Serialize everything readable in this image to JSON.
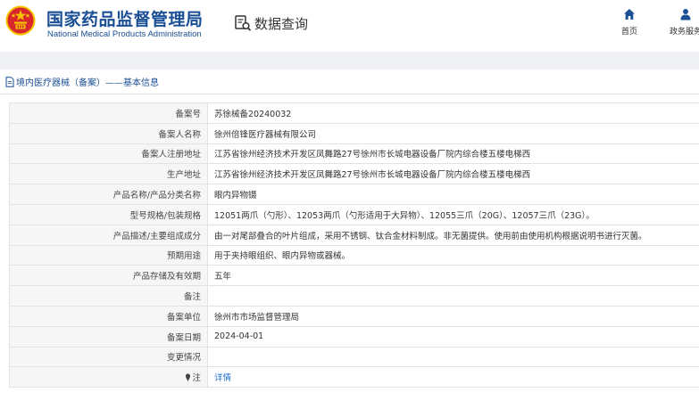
{
  "header": {
    "brand_cn": "国家药品监督管理局",
    "brand_en": "National Medical Products Administration",
    "query_title": "数据查询",
    "nav": [
      {
        "label": "首页",
        "icon": "home-icon"
      },
      {
        "label": "政务服务",
        "icon": "person-icon"
      }
    ]
  },
  "breadcrumb": "境内医疗器械（备案）——基本信息",
  "colors": {
    "brand": "#1a4f95",
    "link": "#1a6fd1",
    "emblem_red": "#d8262c",
    "emblem_gold": "#f5c400"
  },
  "rows": [
    {
      "label": "备案号",
      "value": "苏徐械备20240032"
    },
    {
      "label": "备案人名称",
      "value": "徐州倍锋医疗器械有限公司"
    },
    {
      "label": "备案人注册地址",
      "value": "江苏省徐州经济技术开发区凤舞路27号徐州市长城电器设备厂院内综合楼五楼电梯西"
    },
    {
      "label": "生产地址",
      "value": "江苏省徐州经济技术开发区凤舞路27号徐州市长城电器设备厂院内综合楼五楼电梯西"
    },
    {
      "label": "产品名称/产品分类名称",
      "value": "眼内异物镊"
    },
    {
      "label": "型号规格/包装规格",
      "value": "12051两爪（勺形）、12053两爪（勺形适用于大异物）、12055三爪（20G）、12057三爪（23G）。"
    },
    {
      "label": "产品描述/主要组成成分",
      "value": "由一对尾部叠合的叶片组成，采用不锈钢、钛合金材料制成。非无菌提供。使用前由使用机构根据说明书进行灭菌。"
    },
    {
      "label": "预期用途",
      "value": "用于夹持眼组织、眼内异物或器械。"
    },
    {
      "label": "产品存储及有效期",
      "value": "五年"
    },
    {
      "label": "备注",
      "value": ""
    },
    {
      "label": "备案单位",
      "value": "徐州市市场监督管理局"
    },
    {
      "label": "备案日期",
      "value": "2024-04-01"
    },
    {
      "label": "变更情况",
      "value": ""
    }
  ],
  "note_row": {
    "label": "注",
    "link": "详情",
    "icon": "pin-icon"
  }
}
